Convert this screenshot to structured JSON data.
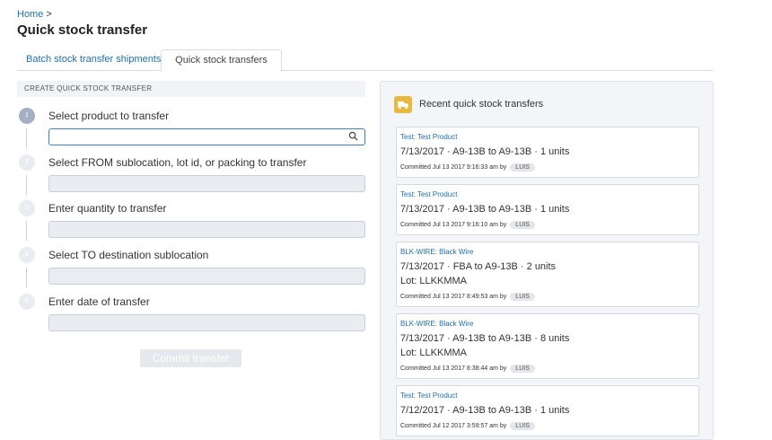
{
  "breadcrumb": {
    "home": "Home",
    "sep": ">"
  },
  "page_title": "Quick stock transfer",
  "tabs": [
    {
      "label": "Batch stock transfer shipments"
    },
    {
      "label": "Quick stock transfers"
    }
  ],
  "form": {
    "header": "CREATE QUICK STOCK TRANSFER",
    "steps": [
      {
        "num": "1",
        "label": "Select product to transfer"
      },
      {
        "num": "2",
        "label": "Select FROM sublocation, lot id, or packing to transfer"
      },
      {
        "num": "3",
        "label": "Enter quantity to transfer"
      },
      {
        "num": "4",
        "label": "Select TO destination sublocation"
      },
      {
        "num": "5",
        "label": "Enter date of transfer"
      }
    ],
    "commit_label": "Commit transfer"
  },
  "recent": {
    "title": "Recent quick stock transfers",
    "items": [
      {
        "product": "Test: Test Product",
        "line1": "7/13/2017 · A9-13B to A9-13B · 1 units",
        "line2": "",
        "committed": "Committed Jul 13 2017 9:16:33 am by",
        "user": "LUIS"
      },
      {
        "product": "Test: Test Product",
        "line1": "7/13/2017 · A9-13B to A9-13B · 1 units",
        "line2": "",
        "committed": "Committed Jul 13 2017 9:16:10 am by",
        "user": "LUIS"
      },
      {
        "product": "BLK-WIRE: Black Wire",
        "line1": "7/13/2017 · FBA to A9-13B · 2 units",
        "line2": "Lot: LLKKMMA",
        "committed": "Committed Jul 13 2017 8:49:53 am by",
        "user": "LUIS"
      },
      {
        "product": "BLK-WIRE: Black Wire",
        "line1": "7/13/2017 · A9-13B to A9-13B · 8 units",
        "line2": "Lot: LLKKMMA",
        "committed": "Committed Jul 13 2017 8:38:44 am by",
        "user": "LUIS"
      },
      {
        "product": "Test: Test Product",
        "line1": "7/12/2017 · A9-13B to A9-13B · 1 units",
        "line2": "",
        "committed": "Committed Jul 12 2017 3:59:57 am by",
        "user": "LUIS"
      }
    ]
  }
}
